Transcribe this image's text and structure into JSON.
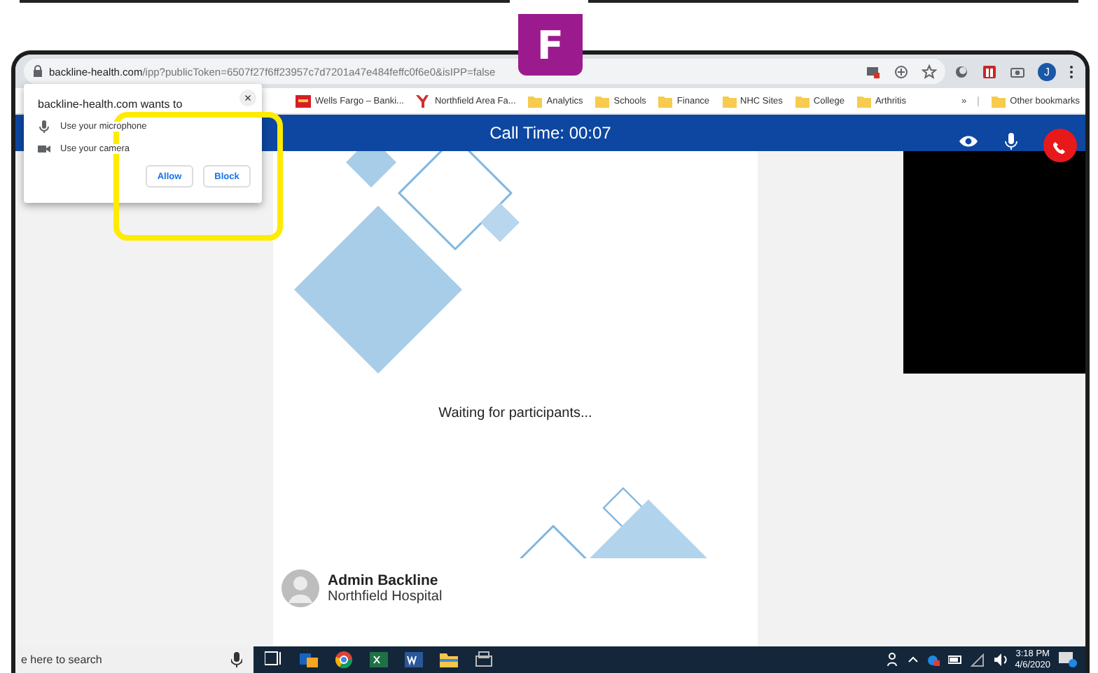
{
  "step_badge": "F",
  "browser": {
    "url_host": "backline-health.com",
    "url_path": "/ipp?publicToken=6507f27f6ff23957c7d7201a47e484feffc0f6e0&isIPP=false",
    "profile_initial": "J"
  },
  "bookmarks": [
    {
      "label": "Wells Fargo – Banki...",
      "kind": "bank"
    },
    {
      "label": "Northfield Area Fa...",
      "kind": "y"
    },
    {
      "label": "Analytics",
      "kind": "folder"
    },
    {
      "label": "Schools",
      "kind": "folder"
    },
    {
      "label": "Finance",
      "kind": "folder"
    },
    {
      "label": "NHC Sites",
      "kind": "folder"
    },
    {
      "label": "College",
      "kind": "folder"
    },
    {
      "label": "Arthritis",
      "kind": "folder"
    }
  ],
  "bookmarks_more": "»",
  "other_bookmarks": "Other bookmarks",
  "permission_popup": {
    "title": "backline-health.com wants to",
    "close": "×",
    "requests": [
      {
        "label": "Use your microphone",
        "kind": "mic"
      },
      {
        "label": "Use your camera",
        "kind": "camera"
      }
    ],
    "buttons": [
      "Allow",
      "Block"
    ]
  },
  "call": {
    "title": "Call Time: 00:07",
    "status": "Waiting for participants...",
    "participant": {
      "name": "Admin Backline",
      "organization": "Northfield Hospital"
    }
  },
  "taskbar": {
    "search_placeholder": "e here to search",
    "time": "3:18 PM",
    "date": "4/6/2020"
  }
}
